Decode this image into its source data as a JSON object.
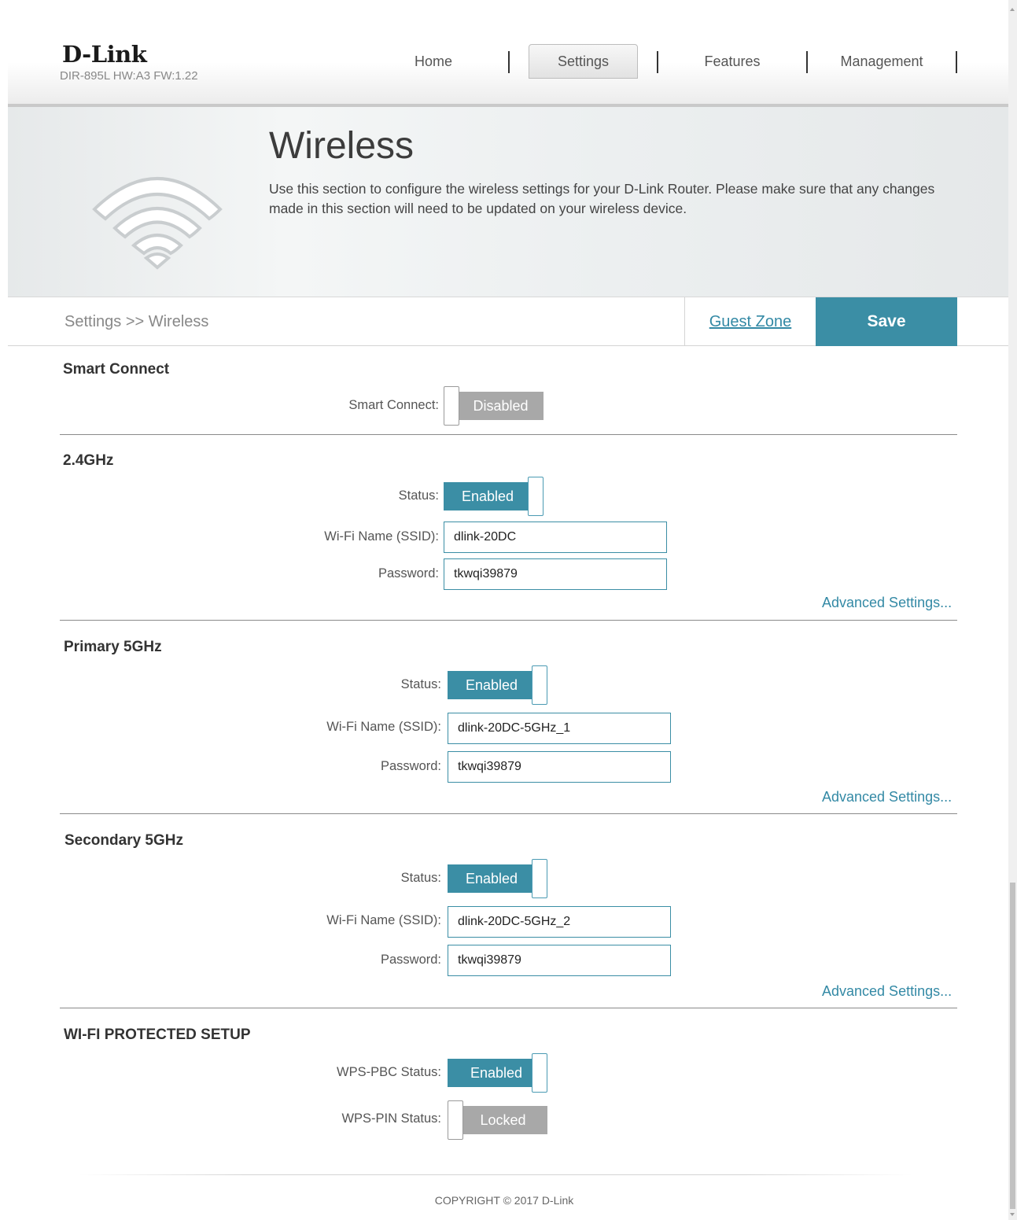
{
  "header": {
    "logo": "D-Link",
    "model": "DIR-895L HW:A3 FW:1.22",
    "nav": [
      {
        "label": "Home",
        "active": false
      },
      {
        "label": "Settings",
        "active": true
      },
      {
        "label": "Features",
        "active": false
      },
      {
        "label": "Management",
        "active": false
      }
    ]
  },
  "hero": {
    "title": "Wireless",
    "description": "Use this section to configure the wireless settings for your D-Link Router. Please make sure that any changes made in this section will need to be updated on your wireless device.",
    "icon": "wifi-icon"
  },
  "breadcrumb": "Settings >> Wireless",
  "actions": {
    "guest_zone": "Guest Zone",
    "save": "Save"
  },
  "smart_connect": {
    "title": "Smart Connect",
    "label": "Smart Connect:",
    "state": "Disabled"
  },
  "band_24": {
    "title": "2.4GHz",
    "status_label": "Status:",
    "status": "Enabled",
    "ssid_label": "Wi-Fi Name (SSID):",
    "ssid": "dlink-20DC",
    "password_label": "Password:",
    "password": "tkwqi39879",
    "advanced": "Advanced Settings..."
  },
  "band_5_primary": {
    "title": "Primary 5GHz",
    "status_label": "Status:",
    "status": "Enabled",
    "ssid_label": "Wi-Fi Name (SSID):",
    "ssid": "dlink-20DC-5GHz_1",
    "password_label": "Password:",
    "password": "tkwqi39879",
    "advanced": "Advanced Settings..."
  },
  "band_5_secondary": {
    "title": "Secondary 5GHz",
    "status_label": "Status:",
    "status": "Enabled",
    "ssid_label": "Wi-Fi Name (SSID):",
    "ssid": "dlink-20DC-5GHz_2",
    "password_label": "Password:",
    "password": "tkwqi39879",
    "advanced": "Advanced Settings..."
  },
  "wps": {
    "title": "WI-FI PROTECTED SETUP",
    "pbc_label": "WPS-PBC Status:",
    "pbc": "Enabled",
    "pin_label": "WPS-PIN Status:",
    "pin": "Locked"
  },
  "footer": {
    "copyright": "COPYRIGHT © 2017 D-Link"
  },
  "colors": {
    "accent": "#3b8ea5",
    "link": "#3389a5",
    "toggle_off": "#a8a8a8"
  }
}
